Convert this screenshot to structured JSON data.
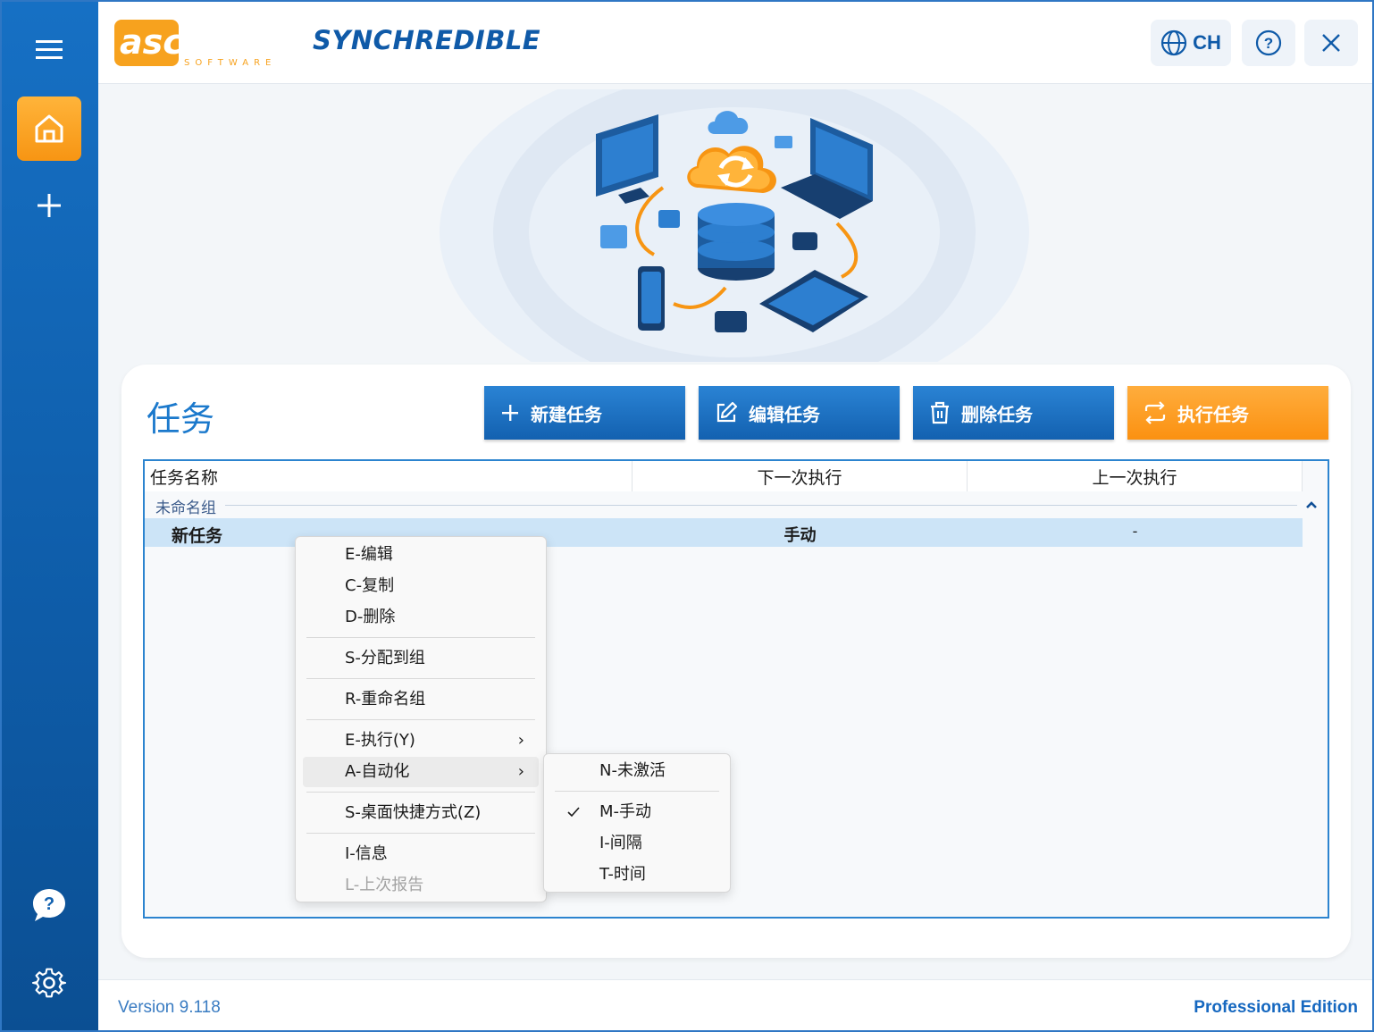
{
  "brand": {
    "logo_text": "ascomp",
    "logo_sub": "SOFTWARE",
    "product": "SYNCHREDIBLE"
  },
  "header": {
    "language": "CH",
    "icons": [
      "globe-icon",
      "help-icon",
      "close-icon"
    ]
  },
  "sidebar": {
    "items": [
      "menu-icon",
      "home-icon",
      "plus-icon",
      "chat-help-icon",
      "gear-icon"
    ]
  },
  "tasks": {
    "title": "任务",
    "buttons": {
      "new": "新建任务",
      "edit": "编辑任务",
      "delete": "删除任务",
      "run": "执行任务"
    },
    "columns": {
      "name": "任务名称",
      "next": "下一次执行",
      "last": "上一次执行"
    },
    "group": "未命名组",
    "rows": [
      {
        "name": "新任务",
        "next": "手动",
        "last": "-"
      }
    ]
  },
  "context_menu": {
    "items": [
      "E-编辑",
      "C-复制",
      "D-删除",
      "S-分配到组",
      "R-重命名组",
      "E-执行(Y)",
      "A-自动化",
      "S-桌面快捷方式(Z)",
      "I-信息",
      "L-上次报告"
    ],
    "highlighted": "A-自动化",
    "disabled": "L-上次报告"
  },
  "submenu": {
    "items": [
      "N-未激活",
      "M-手动",
      "I-间隔",
      "T-时间"
    ],
    "checked": "M-手动"
  },
  "footer": {
    "version": "Version 9.118",
    "edition": "Professional Edition"
  },
  "colors": {
    "primary": "#1670c4",
    "accent": "#fb9111",
    "selection": "#cce4f7"
  }
}
